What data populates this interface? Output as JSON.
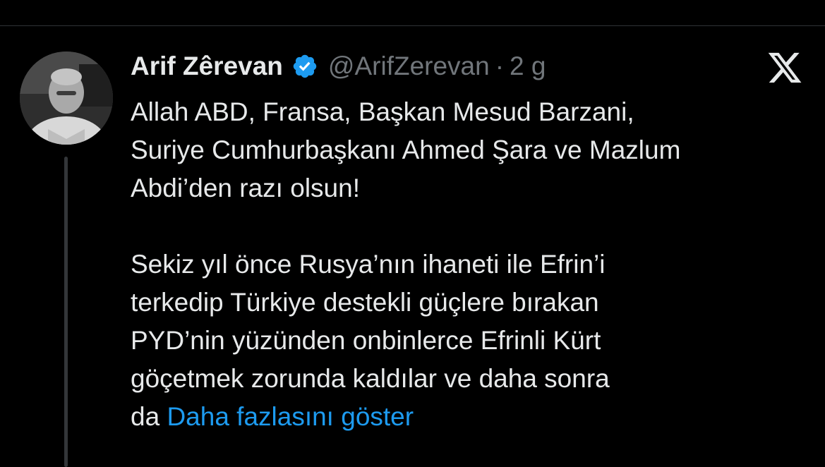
{
  "tweet": {
    "author_name": "Arif Zêrevan",
    "author_handle": "@ArifZerevan",
    "separator": "·",
    "time": "2 g",
    "verified": true,
    "paragraph1": [
      "Allah ABD, Fransa, Başkan Mesud Barzani,",
      "Suriye Cumhurbaşkanı Ahmed Şara ve Mazlum",
      "Abdi’den razı olsun!"
    ],
    "paragraph2": [
      "Sekiz yıl önce Rusya’nın ihaneti ile Efrin’i",
      "terkedip Türkiye destekli güçlere bırakan",
      "PYD’nin yüzünden onbinlerce Efrinli Kürt",
      "göçetmek zorunda kaldılar ve daha sonra"
    ],
    "last_line_prefix": "da",
    "show_more_label": "Daha fazlasını göster"
  },
  "icons": {
    "verified": "verified-badge-icon",
    "platform": "x-logo-icon"
  },
  "colors": {
    "background": "#000000",
    "text_primary": "#e7e9ea",
    "text_secondary": "#71767b",
    "accent": "#1d9bf0",
    "divider": "#2f3336"
  }
}
